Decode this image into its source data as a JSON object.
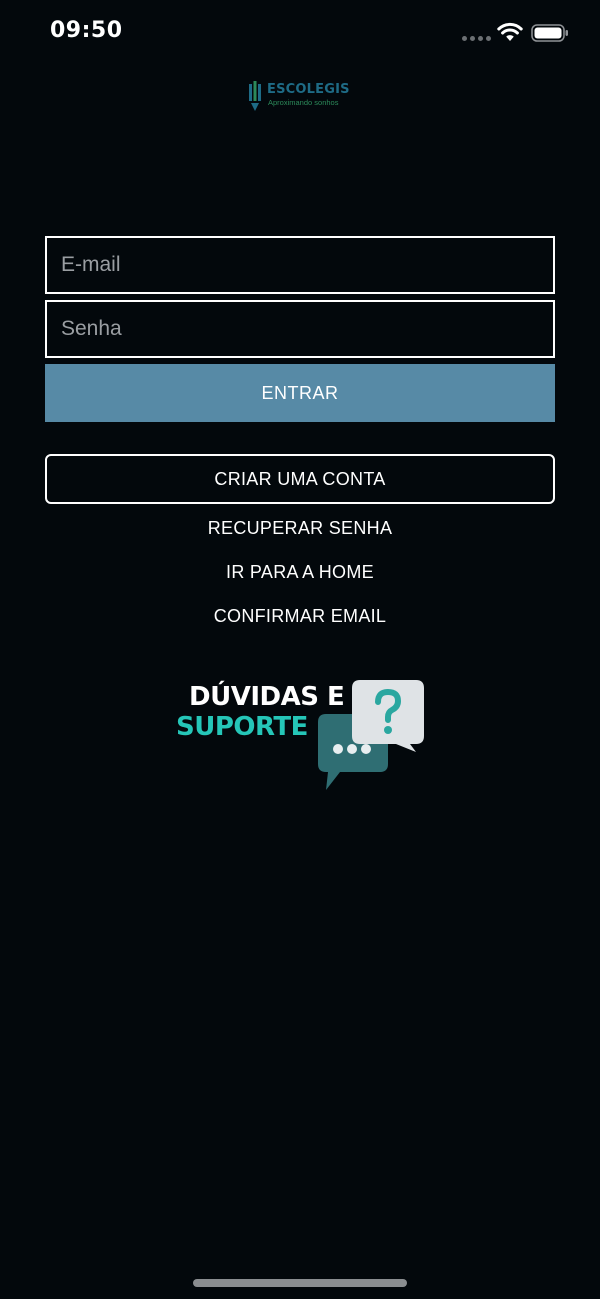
{
  "status_bar": {
    "time": "09:50",
    "icons": [
      "signal-dots-icon",
      "wifi-icon",
      "battery-icon"
    ]
  },
  "logo": {
    "name": "ESCOLEGIS",
    "tagline": "Aproximando sonhos",
    "colors": {
      "name": "#1e6b86",
      "tagline": "#2c8a5a"
    }
  },
  "login_form": {
    "email_placeholder": "E-mail",
    "email_value": "",
    "password_placeholder": "Senha",
    "password_value": "",
    "submit_label": "ENTRAR"
  },
  "actions": {
    "create_account_label": "CRIAR UMA CONTA",
    "recover_password_label": "RECUPERAR SENHA",
    "go_home_label": "IR PARA A HOME",
    "confirm_email_label": "CONFIRMAR EMAIL"
  },
  "support": {
    "line1": "DÚVIDAS E",
    "line2": "SUPORTE",
    "icons": [
      "question-bubble-icon",
      "chat-dots-bubble-icon"
    ]
  },
  "colors": {
    "background": "#03080c",
    "primary_button": "#578aa6",
    "support_accent": "#25c6b8"
  }
}
